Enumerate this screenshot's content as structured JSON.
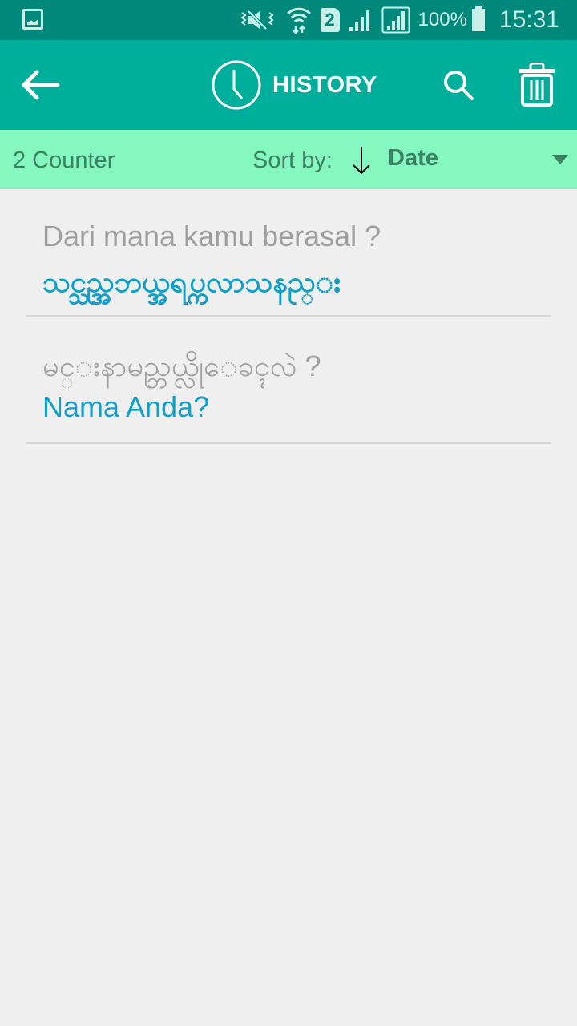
{
  "status_bar": {
    "left_icon": "gallery-notification-icon",
    "icons": [
      "vibrate-mute-icon",
      "wifi-data-icon",
      "sim-2-icon",
      "signal-icon",
      "signal-roaming-icon"
    ],
    "sim_label": "2",
    "battery_percent": "100%",
    "time": "15:31"
  },
  "app_bar": {
    "back_icon": "arrow-back-icon",
    "title_icon": "clock-icon",
    "title": "HISTORY",
    "search_icon": "search-icon",
    "delete_icon": "trash-icon",
    "background_color": "#00ae9c"
  },
  "sort_bar": {
    "counter": "2 Counter",
    "sort_label": "Sort by:",
    "sort_direction_icon": "arrow-down-icon",
    "sort_value": "Date",
    "background_color": "#84f8c0"
  },
  "history": [
    {
      "source": "Dari mana kamu berasal ?",
      "target": "သင္သည္အဘယ္အရပ္ကလာသနည္း"
    },
    {
      "source": "မင္းနာမည္ဘယ္လိုေခၚလဲ ?",
      "target": "Nama Anda?"
    }
  ]
}
